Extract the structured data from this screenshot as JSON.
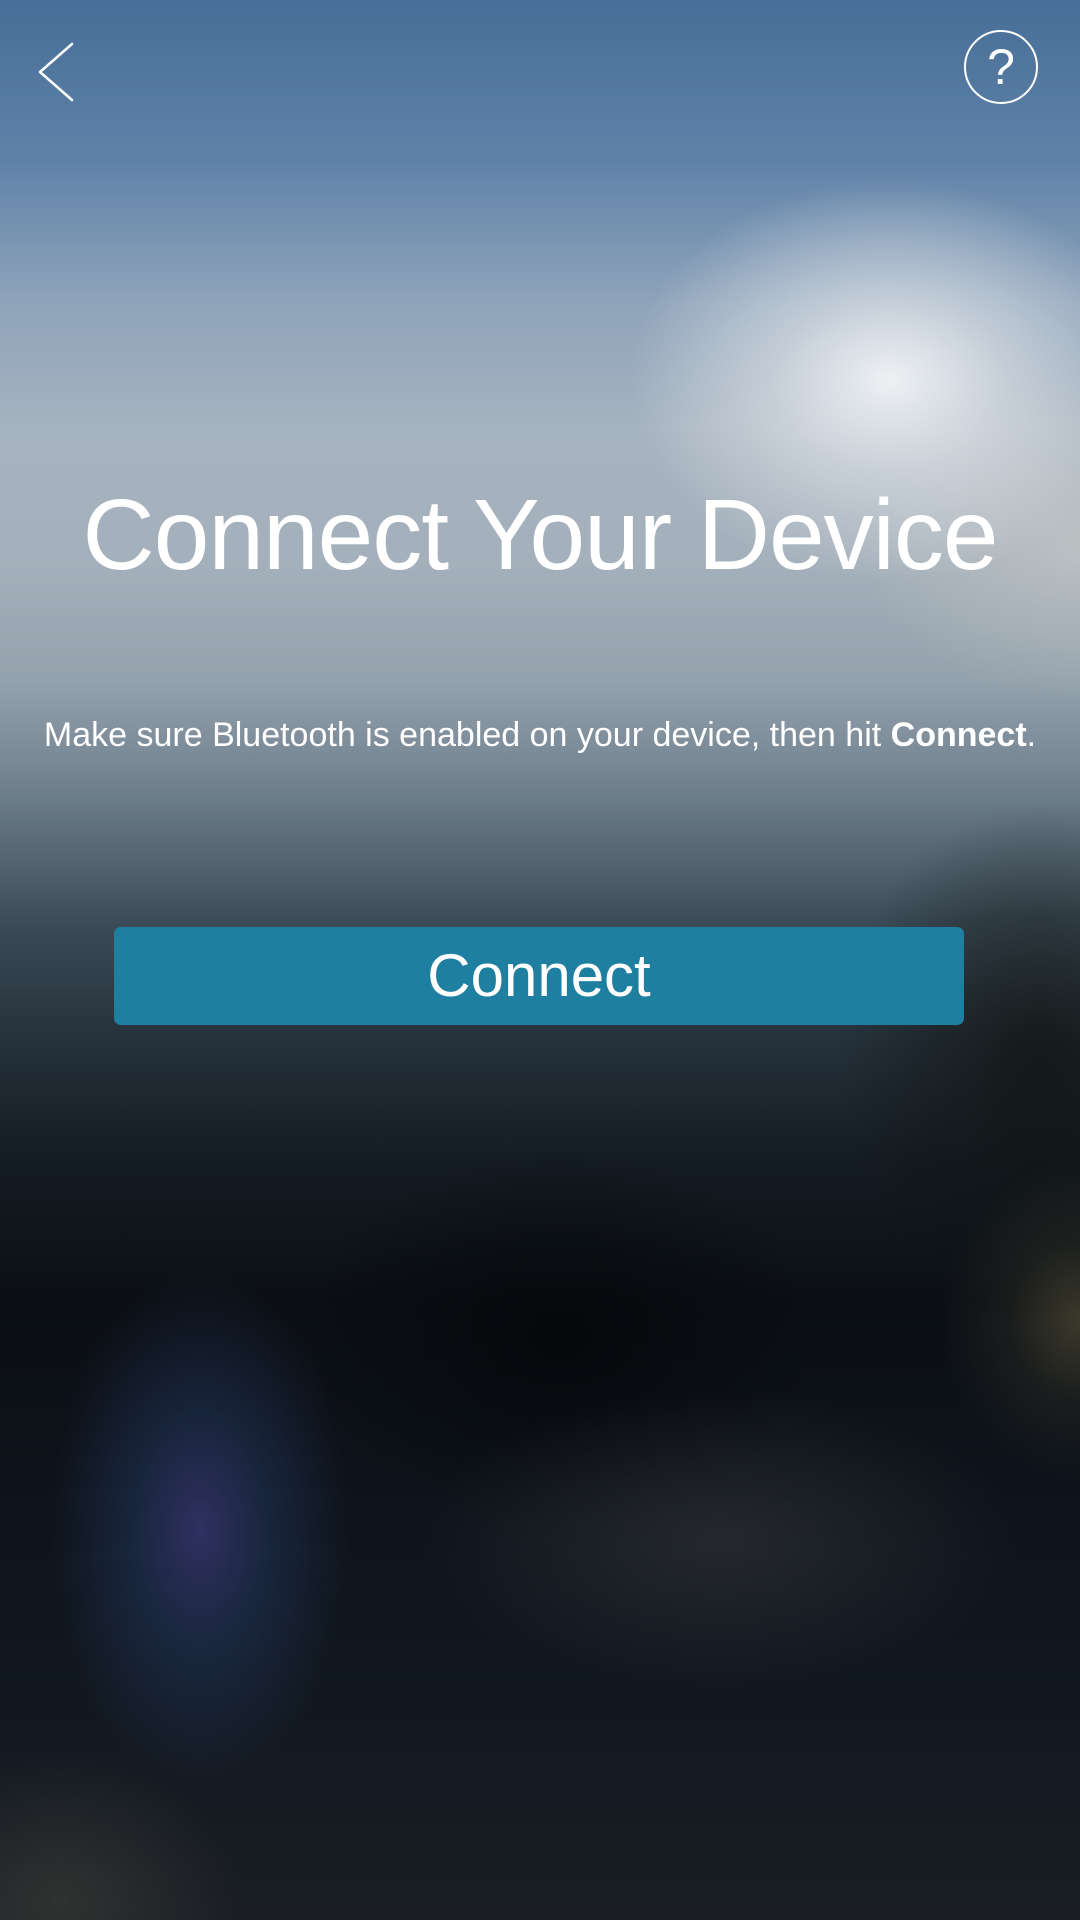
{
  "header": {
    "back_icon": "chevron-left-icon",
    "help_icon": "question-circle-icon",
    "help_glyph": "?"
  },
  "main": {
    "title": "Connect Your Device",
    "instruction": {
      "prefix": "Make sure Bluetooth is enabled on your device, then hit ",
      "emphasis": "Connect",
      "suffix": "."
    },
    "connect_button_label": "Connect"
  },
  "colors": {
    "button_background": "#1f7fa1",
    "text": "#ffffff"
  }
}
